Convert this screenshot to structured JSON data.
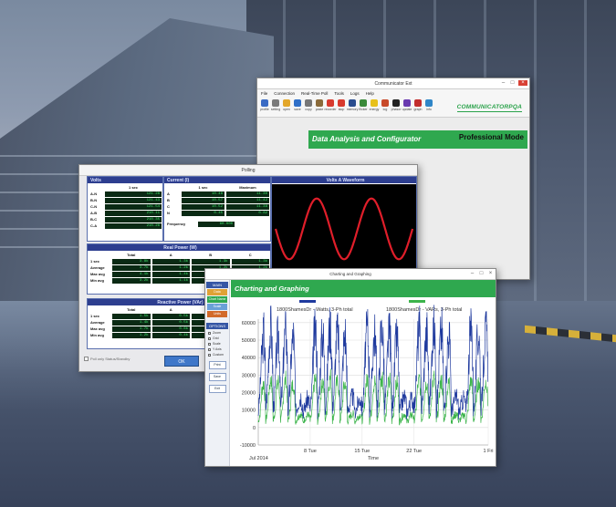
{
  "communicator": {
    "window_title": "Communicator Ext",
    "menu": [
      "File",
      "Connection",
      "Real-Time Poll",
      "Tools",
      "Logs",
      "Help"
    ],
    "toolbar": [
      {
        "label": "profile",
        "icon": "globe-icon",
        "color": "#3a6bc4"
      },
      {
        "label": "setting",
        "icon": "gear-icon",
        "color": "#7a7a7a"
      },
      {
        "label": "open",
        "icon": "folder-icon",
        "color": "#e3a72a"
      },
      {
        "label": "save",
        "icon": "save-icon",
        "color": "#2f6fc8"
      },
      {
        "label": "copy",
        "icon": "copy-icon",
        "color": "#777777"
      },
      {
        "label": "paste",
        "icon": "paste-icon",
        "color": "#8a6a3a"
      },
      {
        "label": "recorder",
        "icon": "record-icon",
        "color": "#d83a2e"
      },
      {
        "label": "stop",
        "icon": "stop-icon",
        "color": "#d83a2e"
      },
      {
        "label": "memory",
        "icon": "chip-icon",
        "color": "#2a4d8f"
      },
      {
        "label": "flicker",
        "icon": "flicker-icon",
        "color": "#3a8a3a"
      },
      {
        "label": "energy",
        "icon": "bulb-icon",
        "color": "#e8c11a"
      },
      {
        "label": "log",
        "icon": "log-icon",
        "color": "#c84a2a"
      },
      {
        "label": "phasor",
        "icon": "phasor-icon",
        "color": "#222222"
      },
      {
        "label": "update",
        "icon": "update-icon",
        "color": "#6a3ab0"
      },
      {
        "label": "graph",
        "icon": "graph-icon",
        "color": "#c22d2d"
      },
      {
        "label": "info",
        "icon": "info-icon",
        "color": "#2f86c8"
      }
    ],
    "brand": "COMMUNICATORPQA",
    "banner": "Data Analysis and Configurator",
    "mode": "Professional Mode"
  },
  "polling": {
    "window_title": "Polling",
    "volts": {
      "title": "Volts",
      "col": "1 sec",
      "rows": [
        {
          "label": "A-N",
          "value": "121.28"
        },
        {
          "label": "B-N",
          "value": "121.43"
        },
        {
          "label": "C-N",
          "value": "121.54"
        },
        {
          "label": "A-B",
          "value": "210.11"
        },
        {
          "label": "B-C",
          "value": "210.35"
        },
        {
          "label": "C-A",
          "value": "210.26"
        }
      ]
    },
    "current": {
      "title": "Current (I)",
      "cols": [
        "1 sec",
        "Maximum"
      ],
      "rows": [
        {
          "label": "A",
          "values": [
            "10.48",
            "11.30"
          ]
        },
        {
          "label": "B",
          "values": [
            "10.57",
            "11.42"
          ]
        },
        {
          "label": "C",
          "values": [
            "10.52",
            "11.38"
          ]
        },
        {
          "label": "N",
          "values": [
            "0.45",
            "0.82"
          ]
        }
      ],
      "frequency_label": "Frequency",
      "frequency": "60.000"
    },
    "waveform_title": "Volts A Waveform",
    "real_power": {
      "title": "Real Power (W)",
      "cols": [
        "Total",
        "A",
        "B",
        "C"
      ],
      "rows": [
        {
          "label": "1 sec",
          "values": [
            "3.8k",
            "1.3k",
            "1.3k",
            "1.3k"
          ]
        },
        {
          "label": "Average",
          "values": [
            "3.7k",
            "1.2k",
            "1.2k",
            "1.2k"
          ]
        },
        {
          "label": "Max avg",
          "values": [
            "4.1k",
            "1.4k",
            "1.4k",
            "1.4k"
          ]
        },
        {
          "label": "Min avg",
          "values": [
            "3.2k",
            "1.1k",
            "1.1k",
            "1.1k"
          ]
        }
      ]
    },
    "reactive_power": {
      "title": "Reactive Power (VAr)",
      "cols": [
        "Total",
        "A",
        "B",
        "C"
      ],
      "rows": [
        {
          "label": "1 sec",
          "values": [
            "1.5k",
            "0.5k",
            "0.5k",
            "0.5k"
          ]
        },
        {
          "label": "Average",
          "values": [
            "1.4k",
            "0.5k",
            "0.5k",
            "0.5k"
          ]
        },
        {
          "label": "Max avg",
          "values": [
            "1.7k",
            "0.6k",
            "0.6k",
            "0.6k"
          ]
        },
        {
          "label": "Min avg",
          "values": [
            "1.2k",
            "0.4k",
            "0.4k",
            "0.4k"
          ]
        }
      ]
    },
    "checkbox_label": "Poll only Status/Standby",
    "ok_label": "OK"
  },
  "charting": {
    "window_title": "Charting and Graphing",
    "banner": "Charting and Graphing",
    "sidebar": {
      "main_header": "MAIN",
      "items": [
        {
          "label": "Data",
          "color": "#e0a236"
        },
        {
          "label": "Chart Name",
          "color": "#2fa84f"
        },
        {
          "label": "Scale",
          "color": "#6aa0d8"
        },
        {
          "label": "Units",
          "color": "#d26a2a"
        }
      ],
      "options_header": "OPTIONS",
      "options": [
        "Zoom",
        "Grid",
        "Scale",
        "Y Axis",
        "Custom"
      ],
      "buttons": [
        "Print",
        "Save",
        "Exit"
      ]
    }
  },
  "chart_data": {
    "type": "line",
    "series": [
      {
        "name": "1800ShamesDr - Watts, 3-Ph total",
        "color": "#1f3a9e"
      },
      {
        "name": "1800ShamesDr - VARs, 3-Ph total",
        "color": "#3cb44b"
      }
    ],
    "x_tick_labels": [
      "8 Tue",
      "15 Tue",
      "22 Tue",
      "1 Fri"
    ],
    "x_start_label": "Jul 2014",
    "xlabel": "Time",
    "y_ticks": [
      60000,
      50000,
      40000,
      30000,
      20000,
      10000,
      0,
      -10000
    ],
    "ylim": [
      -10000,
      62000
    ],
    "grid": true,
    "legend_position": "top",
    "days": 31,
    "watts_daily": [
      [
        8000,
        22000,
        45000,
        55000,
        30000
      ],
      [
        9000,
        24000,
        52000,
        58000,
        28000
      ],
      [
        8500,
        20000,
        48000,
        54000,
        26000
      ],
      [
        9500,
        23000,
        50000,
        57000,
        29000
      ],
      [
        8000,
        21000,
        46000,
        53000,
        27000
      ],
      [
        9000,
        12000,
        16000,
        18000,
        12000
      ],
      [
        8500,
        11000,
        15000,
        17000,
        11000
      ],
      [
        9000,
        23000,
        51000,
        56000,
        30000
      ],
      [
        8500,
        22000,
        49000,
        55000,
        28000
      ],
      [
        9500,
        24000,
        53000,
        58000,
        31000
      ],
      [
        9000,
        23000,
        50000,
        56000,
        29000
      ],
      [
        8500,
        21000,
        47000,
        54000,
        27000
      ],
      [
        9000,
        12000,
        16000,
        18000,
        12000
      ],
      [
        8500,
        11000,
        15000,
        17000,
        11000
      ],
      [
        9000,
        23000,
        50000,
        57000,
        30000
      ],
      [
        8500,
        22000,
        48000,
        55000,
        28000
      ],
      [
        9500,
        24000,
        52000,
        58000,
        31000
      ],
      [
        9000,
        23000,
        49000,
        56000,
        29000
      ],
      [
        8500,
        21000,
        46000,
        53000,
        27000
      ],
      [
        9000,
        12000,
        16000,
        18000,
        12000
      ],
      [
        8500,
        11000,
        15000,
        17000,
        11000
      ],
      [
        9000,
        23000,
        50000,
        56000,
        30000
      ],
      [
        8500,
        22000,
        49000,
        55000,
        28000
      ],
      [
        9500,
        24000,
        53000,
        58000,
        31000
      ],
      [
        9000,
        23000,
        50000,
        56000,
        29000
      ],
      [
        8500,
        21000,
        47000,
        54000,
        27000
      ],
      [
        9000,
        12000,
        16000,
        18000,
        12000
      ],
      [
        8500,
        11000,
        15000,
        17000,
        11000
      ],
      [
        9000,
        23000,
        50000,
        57000,
        30000
      ],
      [
        8500,
        22000,
        48000,
        55000,
        28000
      ],
      [
        9000,
        23000,
        50000,
        56000,
        29000
      ]
    ],
    "vars_daily": [
      [
        3000,
        8000,
        22000,
        26000,
        12000
      ],
      [
        3500,
        9000,
        24000,
        28000,
        11000
      ],
      [
        3200,
        8500,
        23000,
        27000,
        10000
      ],
      [
        3600,
        9200,
        25000,
        28000,
        12000
      ],
      [
        3100,
        8300,
        22000,
        26000,
        11000
      ],
      [
        3000,
        5000,
        7000,
        8000,
        5000
      ],
      [
        2800,
        4800,
        6500,
        7500,
        4800
      ],
      [
        3400,
        9000,
        24000,
        28000,
        12000
      ],
      [
        3200,
        8600,
        23000,
        27000,
        11000
      ],
      [
        3700,
        9400,
        25000,
        29000,
        13000
      ],
      [
        3400,
        9000,
        24000,
        27000,
        12000
      ],
      [
        3200,
        8400,
        22000,
        26000,
        11000
      ],
      [
        3000,
        5000,
        7000,
        8000,
        5000
      ],
      [
        2800,
        4800,
        6500,
        7500,
        4800
      ],
      [
        3400,
        9000,
        24000,
        28000,
        12000
      ],
      [
        3200,
        8600,
        23000,
        27000,
        11000
      ],
      [
        3700,
        9400,
        25000,
        29000,
        13000
      ],
      [
        3400,
        9000,
        24000,
        27000,
        12000
      ],
      [
        3200,
        8400,
        22000,
        26000,
        11000
      ],
      [
        3000,
        5000,
        7000,
        8000,
        5000
      ],
      [
        2800,
        4800,
        6500,
        7500,
        4800
      ],
      [
        3400,
        9000,
        24000,
        28000,
        12000
      ],
      [
        3200,
        8600,
        23000,
        27000,
        11000
      ],
      [
        3700,
        9400,
        25000,
        29000,
        13000
      ],
      [
        3400,
        9000,
        24000,
        27000,
        12000
      ],
      [
        3200,
        8400,
        22000,
        26000,
        11000
      ],
      [
        3000,
        5000,
        7000,
        8000,
        5000
      ],
      [
        2800,
        4800,
        6500,
        7500,
        4800
      ],
      [
        3400,
        9000,
        24000,
        28000,
        12000
      ],
      [
        3200,
        8600,
        23000,
        27000,
        11000
      ],
      [
        3400,
        9000,
        24000,
        27000,
        12000
      ]
    ]
  },
  "waveform_chart": {
    "type": "line",
    "cycles": 2.5,
    "color": "#e01e2a",
    "background": "#000000"
  }
}
